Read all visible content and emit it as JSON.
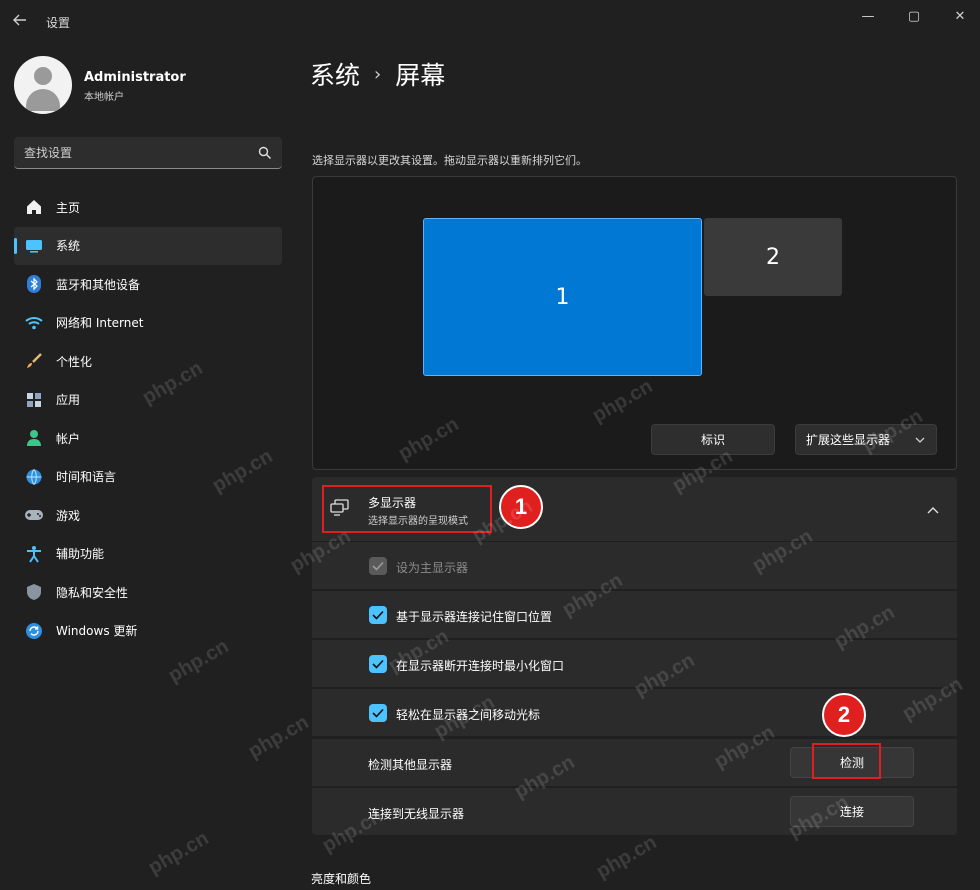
{
  "window": {
    "title": "设置",
    "back_icon": "arrow-left-icon",
    "minimize_glyph": "—",
    "maximize_glyph": "▢",
    "close_glyph": "✕"
  },
  "profile": {
    "name": "Administrator",
    "account_type": "本地帐户"
  },
  "search": {
    "placeholder": "查找设置",
    "icon": "search-icon"
  },
  "sidebar": {
    "items": [
      {
        "label": "主页",
        "icon": "home-icon",
        "active": false
      },
      {
        "label": "系统",
        "icon": "system-icon",
        "active": true
      },
      {
        "label": "蓝牙和其他设备",
        "icon": "bluetooth-icon",
        "active": false
      },
      {
        "label": "网络和 Internet",
        "icon": "wifi-icon",
        "active": false
      },
      {
        "label": "个性化",
        "icon": "brush-icon",
        "active": false
      },
      {
        "label": "应用",
        "icon": "apps-icon",
        "active": false
      },
      {
        "label": "帐户",
        "icon": "account-icon",
        "active": false
      },
      {
        "label": "时间和语言",
        "icon": "globe-clock-icon",
        "active": false
      },
      {
        "label": "游戏",
        "icon": "gamepad-icon",
        "active": false
      },
      {
        "label": "辅助功能",
        "icon": "accessibility-icon",
        "active": false
      },
      {
        "label": "隐私和安全性",
        "icon": "shield-icon",
        "active": false
      },
      {
        "label": "Windows 更新",
        "icon": "update-icon",
        "active": false
      }
    ]
  },
  "main": {
    "breadcrumb_parent": "系统",
    "breadcrumb_separator": "›",
    "breadcrumb_current": "屏幕",
    "instruction": "选择显示器以更改其设置。拖动显示器以重新排列它们。",
    "monitor_1_label": "1",
    "monitor_2_label": "2",
    "identify_label": "标识",
    "extend_select_value": "扩展这些显示器",
    "multi_display": {
      "title": "多显示器",
      "subtitle": "选择显示器的呈现模式",
      "expanded": true
    },
    "rows": {
      "primary_display": {
        "label": "设为主显示器",
        "checked": true,
        "disabled": true
      },
      "remember_windows": {
        "label": "基于显示器连接记住窗口位置",
        "checked": true
      },
      "minimize_on_disconnect": {
        "label": "在显示器断开连接时最小化窗口",
        "checked": true
      },
      "ease_cursor": {
        "label": "轻松在显示器之间移动光标",
        "checked": true
      },
      "detect": {
        "label": "检测其他显示器",
        "button": "检测"
      },
      "wireless": {
        "label": "连接到无线显示器",
        "button": "连接"
      }
    },
    "next_section": "亮度和颜色"
  },
  "annotations": {
    "marker_1": "1",
    "marker_2": "2",
    "color": "#e01f1f"
  },
  "watermark": "php.cn",
  "colors": {
    "accent": "#4cc2ff",
    "monitor_selected": "#0078d4",
    "background": "#202020",
    "card": "#2b2b2b"
  }
}
